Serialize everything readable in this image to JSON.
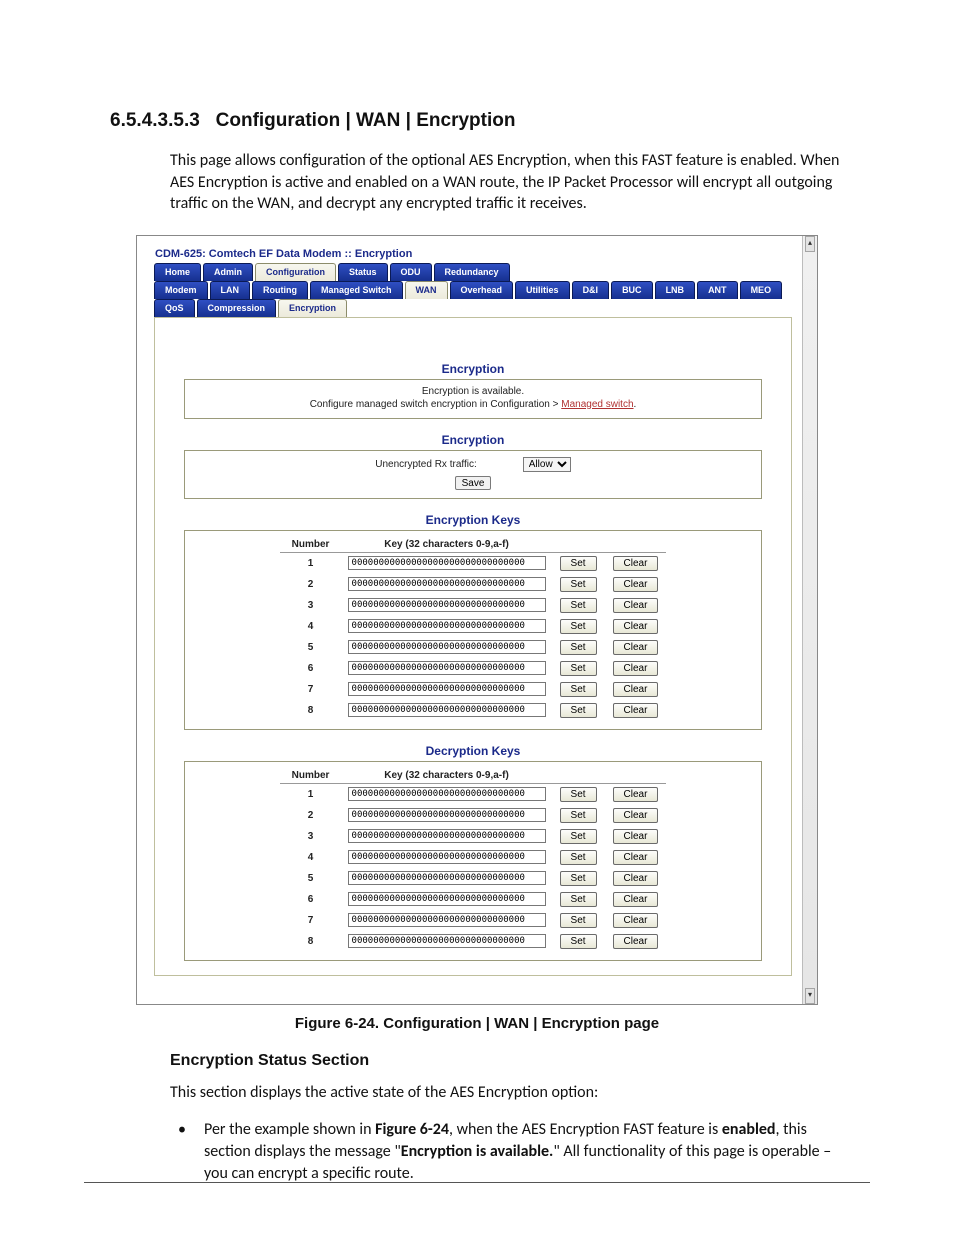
{
  "doc": {
    "heading_number": "6.5.4.3.5.3",
    "heading_text": "Configuration | WAN | Encryption",
    "intro": "This page allows configuration of the optional AES Encryption, when this FAST feature is enabled. When AES Encryption is active and enabled on a WAN route, the IP Packet Processor will encrypt all outgoing traffic on the WAN, and decrypt any encrypted traffic it receives.",
    "figure_caption": "Figure 6-24. Configuration | WAN | Encryption page",
    "h2": "Encryption Status Section",
    "h2_body": "This section displays the active state of the AES Encryption option:",
    "bullet_pre": "Per the example shown in ",
    "bullet_figref": "Figure 6-24",
    "bullet_mid": ", when the AES Encryption FAST feature is ",
    "bullet_enabled": "enabled",
    "bullet_mid2": ", this section displays the message \"",
    "bullet_avail": "Encryption is available.",
    "bullet_post": "\" All functionality of this page is operable – you can encrypt a specific route."
  },
  "ui": {
    "window_title": "CDM-625: Comtech EF Data Modem :: Encryption",
    "tabs_row1": [
      "Home",
      "Admin",
      "Configuration",
      "Status",
      "ODU",
      "Redundancy"
    ],
    "tabs_row1_selected": "Configuration",
    "tabs_row2": [
      "Modem",
      "LAN",
      "Routing",
      "Managed Switch",
      "WAN",
      "Overhead",
      "Utilities",
      "D&I",
      "BUC",
      "LNB",
      "ANT",
      "MEO"
    ],
    "tabs_row2_selected": "WAN",
    "tabs_row3": [
      "QoS",
      "Compression",
      "Encryption"
    ],
    "tabs_row3_selected": "Encryption",
    "sec1_head": "Encryption",
    "sec1_line1": "Encryption is available.",
    "sec1_line2_pre": "Configure managed switch encryption in Configuration > ",
    "sec1_link": "Managed switch",
    "sec1_line2_post": ".",
    "sec2_head": "Encryption",
    "sec2_label": "Unencrypted Rx traffic:",
    "sec2_select": "Allow",
    "sec2_save": "Save",
    "enc_head": "Encryption Keys",
    "dec_head": "Decryption Keys",
    "col_number": "Number",
    "col_key": "Key (32 characters 0-9,a-f)",
    "btn_set": "Set",
    "btn_clear": "Clear",
    "rows": [
      {
        "n": "1",
        "v": "00000000000000000000000000000000"
      },
      {
        "n": "2",
        "v": "00000000000000000000000000000000"
      },
      {
        "n": "3",
        "v": "00000000000000000000000000000000"
      },
      {
        "n": "4",
        "v": "00000000000000000000000000000000"
      },
      {
        "n": "5",
        "v": "00000000000000000000000000000000"
      },
      {
        "n": "6",
        "v": "00000000000000000000000000000000"
      },
      {
        "n": "7",
        "v": "00000000000000000000000000000000"
      },
      {
        "n": "8",
        "v": "00000000000000000000000000000000"
      }
    ]
  }
}
